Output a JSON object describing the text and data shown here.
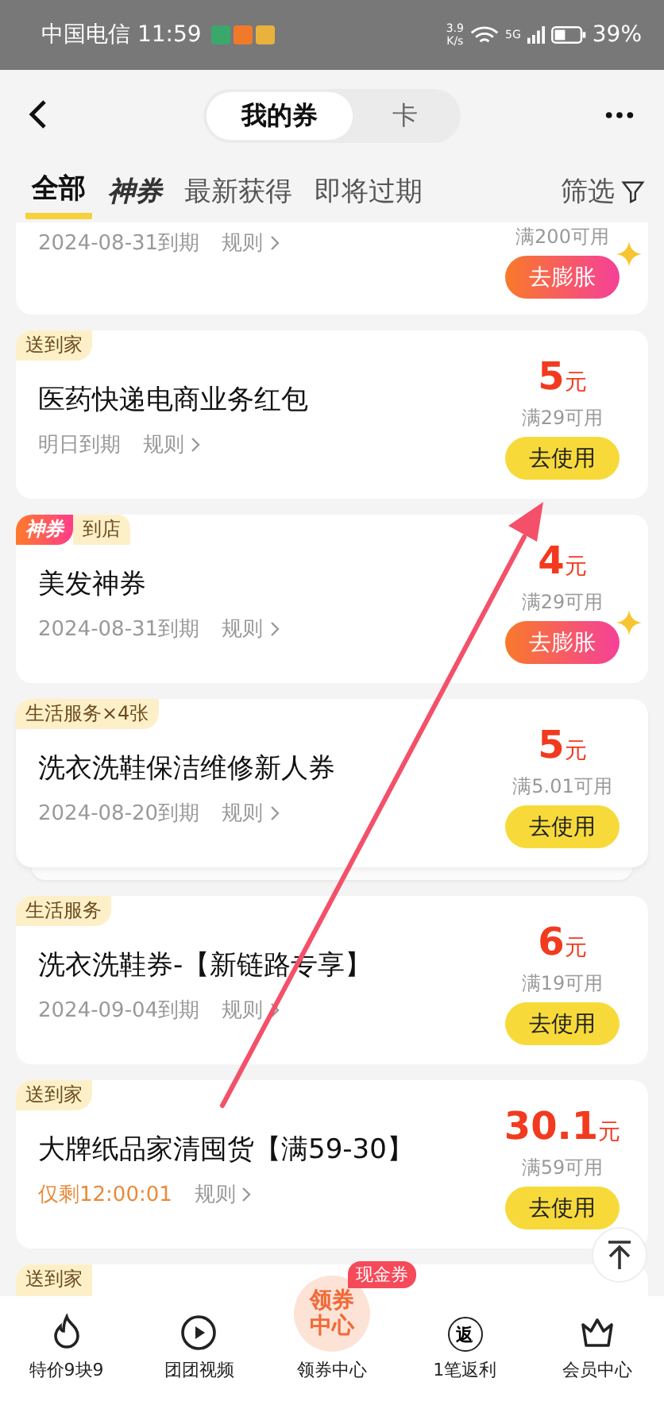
{
  "status_bar": {
    "carrier_time": "中国电信 11:59",
    "speed_value": "3.9",
    "speed_unit": "K/s",
    "network": "5G",
    "battery": "39%"
  },
  "header": {
    "segments": [
      {
        "label": "我的券",
        "selected": true
      },
      {
        "label": "卡",
        "selected": false
      }
    ]
  },
  "tabs": [
    {
      "label": "全部",
      "selected": true,
      "kind": "plain"
    },
    {
      "label": "神券",
      "selected": false,
      "kind": "brand"
    },
    {
      "label": "最新获得",
      "selected": false,
      "kind": "plain"
    },
    {
      "label": "即将过期",
      "selected": false,
      "kind": "plain"
    }
  ],
  "filter": {
    "label": "筛选"
  },
  "coupons": [
    {
      "partial": true,
      "expiry": "2024-08-31到期",
      "urgent": false,
      "rule": "规则",
      "condition": "满200可用",
      "button": {
        "label": "去膨胀",
        "kind": "inflate"
      },
      "stacked": false
    },
    {
      "partial": false,
      "tags": [
        {
          "text": "送到家",
          "kind": "normal"
        }
      ],
      "title": "医药快递电商业务红包",
      "expiry": "明日到期",
      "urgent": false,
      "rule": "规则",
      "amount": "5",
      "unit": "元",
      "condition": "满29可用",
      "button": {
        "label": "去使用",
        "kind": "use"
      },
      "stacked": false
    },
    {
      "partial": false,
      "tags": [
        {
          "text": "神券",
          "kind": "shen"
        },
        {
          "text": "到店",
          "kind": "normal"
        }
      ],
      "title": "美发神券",
      "expiry": "2024-08-31到期",
      "urgent": false,
      "rule": "规则",
      "amount": "4",
      "unit": "元",
      "condition": "满29可用",
      "button": {
        "label": "去膨胀",
        "kind": "inflate"
      },
      "stacked": false
    },
    {
      "partial": false,
      "tags": [
        {
          "text": "生活服务×4张",
          "kind": "normal"
        }
      ],
      "title": "洗衣洗鞋保洁维修新人券",
      "expiry": "2024-08-20到期",
      "urgent": false,
      "rule": "规则",
      "amount": "5",
      "unit": "元",
      "condition": "满5.01可用",
      "button": {
        "label": "去使用",
        "kind": "use"
      },
      "stacked": true
    },
    {
      "partial": false,
      "tags": [
        {
          "text": "生活服务",
          "kind": "normal"
        }
      ],
      "title": "洗衣洗鞋券-【新链路专享】",
      "expiry": "2024-09-04到期",
      "urgent": false,
      "rule": "规则",
      "amount": "6",
      "unit": "元",
      "condition": "满19可用",
      "button": {
        "label": "去使用",
        "kind": "use"
      },
      "stacked": false
    },
    {
      "partial": false,
      "tags": [
        {
          "text": "送到家",
          "kind": "normal"
        }
      ],
      "title": "大牌纸品家清囤货【满59-30】",
      "expiry": "仅剩12:00:01",
      "urgent": true,
      "rule": "规则",
      "amount": "30.1",
      "unit": "元",
      "condition": "满59可用",
      "button": {
        "label": "去使用",
        "kind": "use"
      },
      "stacked": false
    },
    {
      "partial": false,
      "cut": true,
      "tags": [
        {
          "text": "送到家",
          "kind": "normal"
        }
      ]
    }
  ],
  "bottom_nav": [
    {
      "label": "特价9块9",
      "kind": "flame"
    },
    {
      "label": "团团视频",
      "kind": "play"
    },
    {
      "label": "领券中心",
      "kind": "center",
      "circle_text": "领券中心",
      "badge": "现金券"
    },
    {
      "label": "1笔返利",
      "kind": "rebate",
      "icon_text": "返"
    },
    {
      "label": "会员中心",
      "kind": "crown"
    }
  ]
}
